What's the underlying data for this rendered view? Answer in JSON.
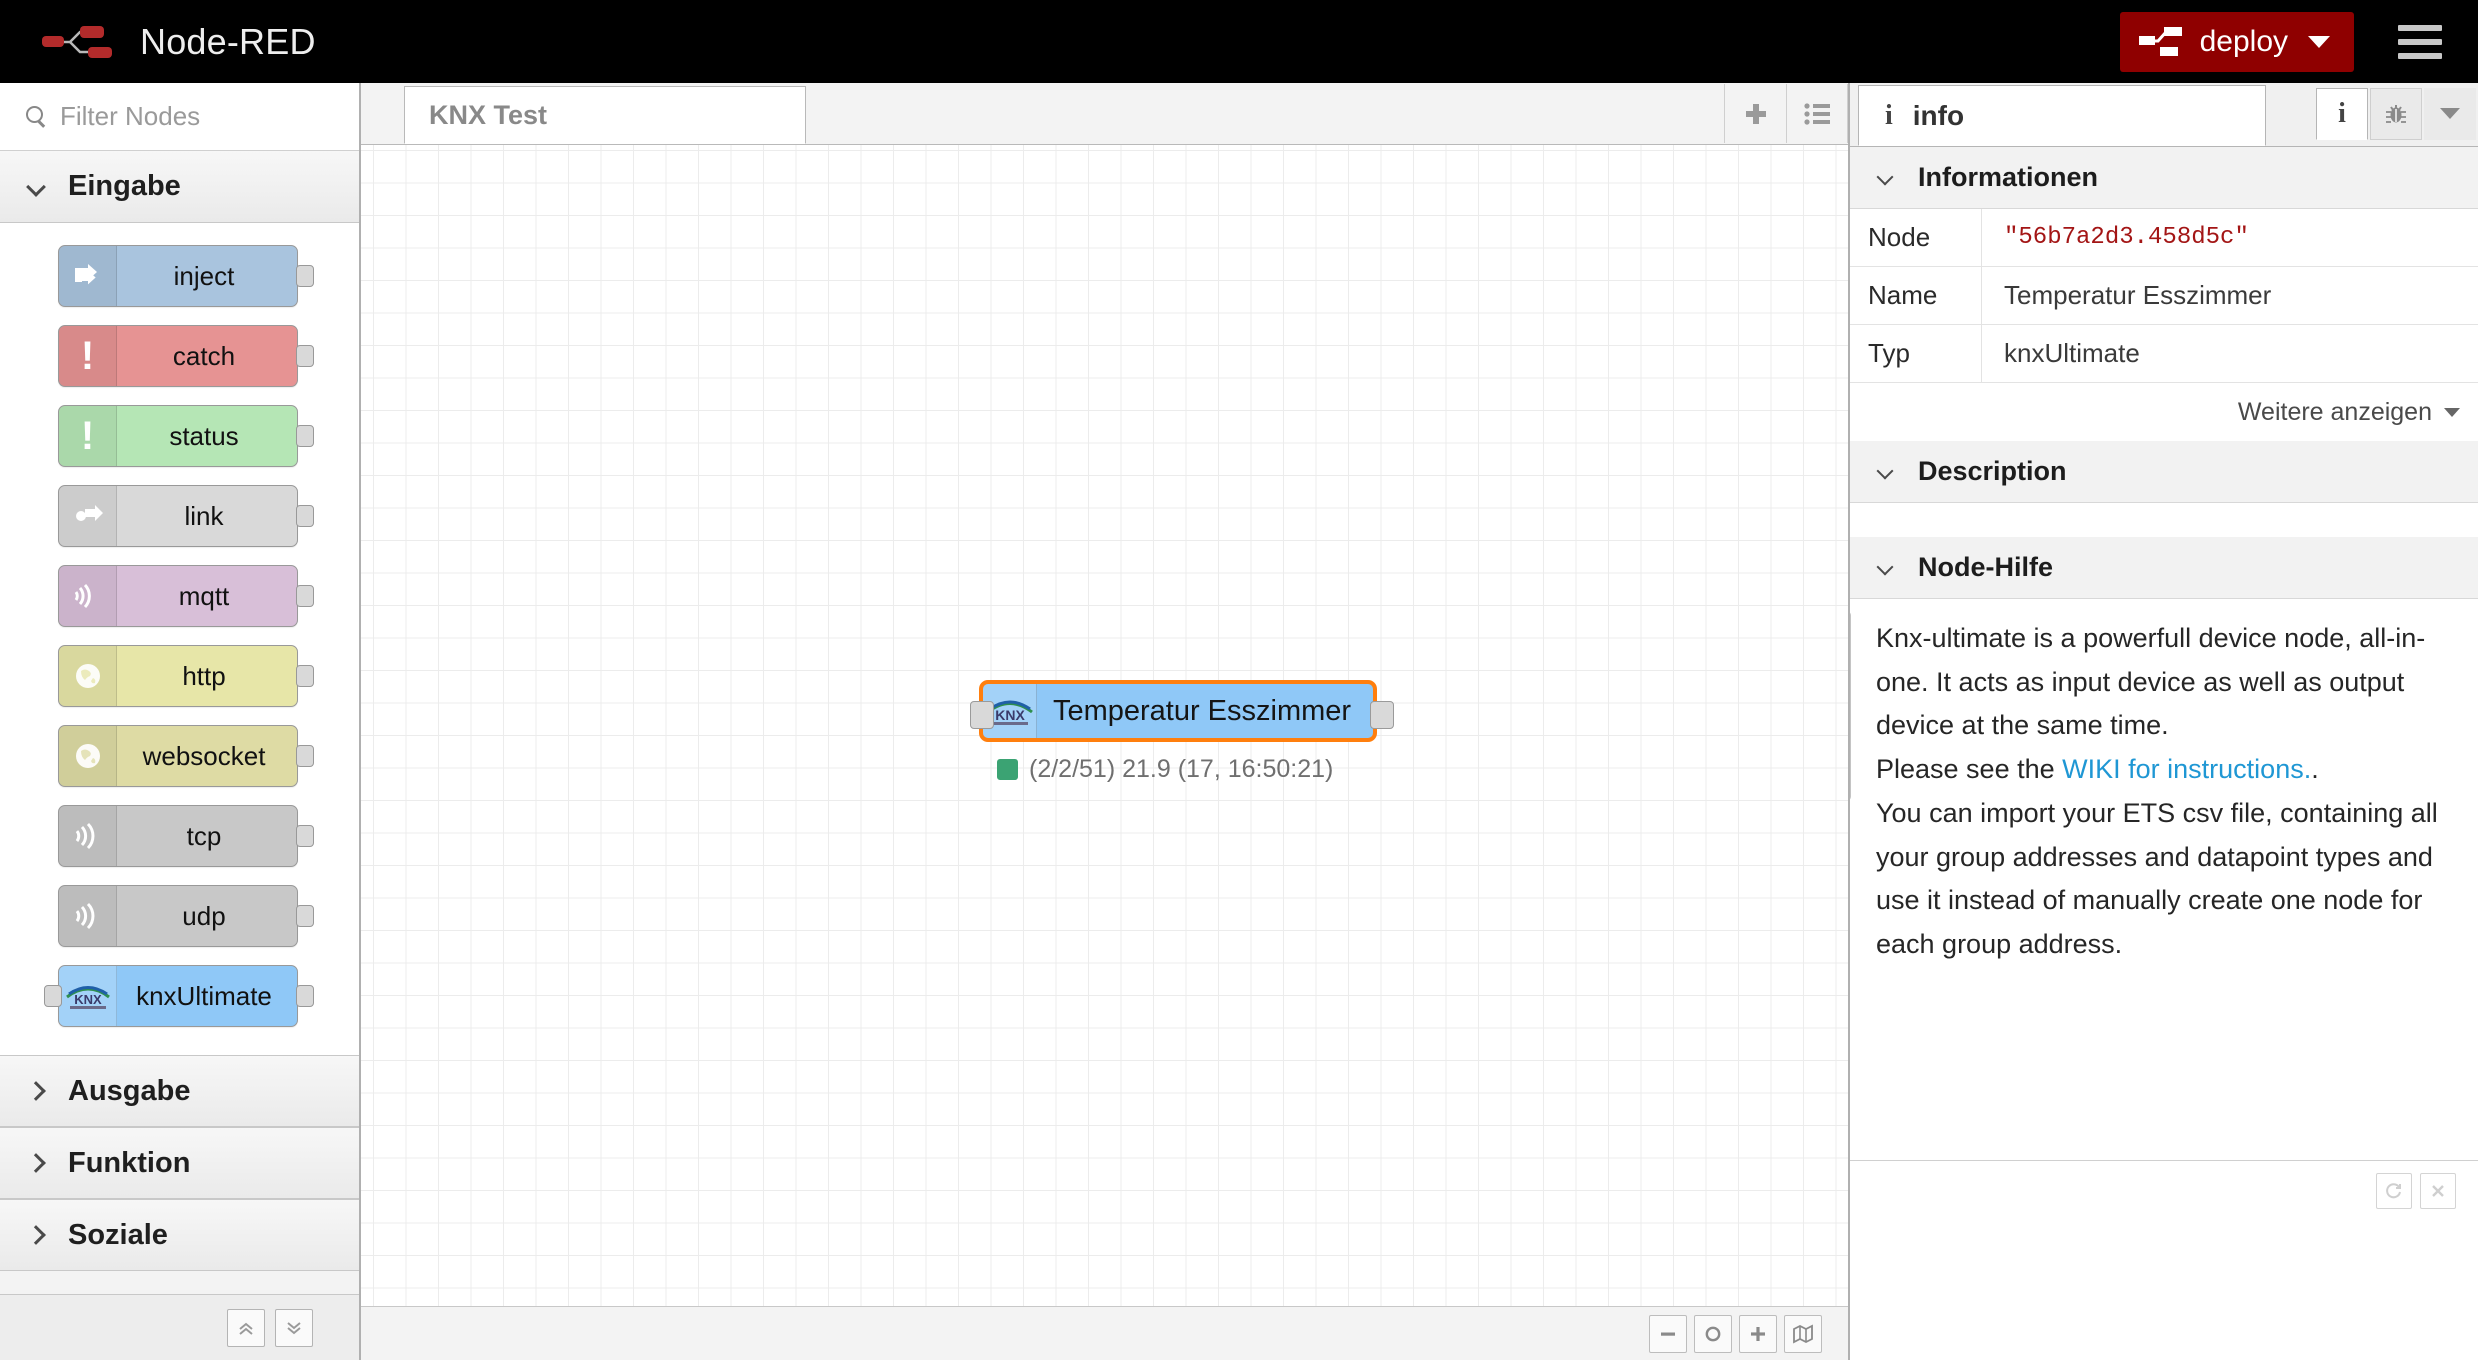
{
  "header": {
    "brand_title": "Node-RED",
    "deploy_label": "deploy",
    "deploy_color": "#8f0000",
    "menu_icon": "hamburger-menu-icon"
  },
  "palette": {
    "search_placeholder": "Filter Nodes",
    "search_value": "",
    "categories": [
      {
        "label": "Eingabe",
        "expanded": true,
        "nodes": [
          {
            "label": "inject",
            "color": "#a9c4de",
            "icon": "inject-arrow-icon",
            "glyph": "⇨",
            "has_input": false,
            "has_output": true
          },
          {
            "label": "catch",
            "color": "#e69393",
            "icon": "exclamation-icon",
            "glyph": "!",
            "has_input": false,
            "has_output": true
          },
          {
            "label": "status",
            "color": "#b5e6b5",
            "icon": "exclamation-icon",
            "glyph": "!",
            "has_input": false,
            "has_output": true
          },
          {
            "label": "link",
            "color": "#d9d9d9",
            "icon": "link-arrow-icon",
            "glyph": "⇨",
            "has_input": false,
            "has_output": true
          },
          {
            "label": "mqtt",
            "color": "#d8bfd8",
            "icon": "signal-wave-icon",
            "glyph": "))",
            "has_input": false,
            "has_output": true
          },
          {
            "label": "http",
            "color": "#e7e6a8",
            "icon": "globe-icon",
            "glyph": "🌍",
            "has_input": false,
            "has_output": true
          },
          {
            "label": "websocket",
            "color": "#dedba4",
            "icon": "globe-icon",
            "glyph": "🌍",
            "has_input": false,
            "has_output": true
          },
          {
            "label": "tcp",
            "color": "#c8c8c8",
            "icon": "signal-wave-icon",
            "glyph": "))",
            "has_input": false,
            "has_output": true
          },
          {
            "label": "udp",
            "color": "#c8c8c8",
            "icon": "signal-wave-icon",
            "glyph": "))",
            "has_input": false,
            "has_output": true
          },
          {
            "label": "knxUltimate",
            "color": "#8fc8f7",
            "icon": "knx-logo-icon",
            "glyph": "KNX",
            "has_input": true,
            "has_output": true
          }
        ]
      },
      {
        "label": "Ausgabe",
        "expanded": false,
        "nodes": []
      },
      {
        "label": "Funktion",
        "expanded": false,
        "nodes": []
      },
      {
        "label": "Soziale",
        "expanded": false,
        "nodes": []
      }
    ],
    "footer": {
      "collapse_all_icon": "chevron-double-up-icon",
      "expand_all_icon": "chevron-double-down-icon"
    }
  },
  "workspace": {
    "tabs": [
      {
        "label": "KNX Test",
        "active": true
      }
    ],
    "add_tab_icon": "plus-icon",
    "list_tabs_icon": "list-icon",
    "node": {
      "name": "Temperatur Esszimmer",
      "icon": "knx-logo-icon",
      "icon_text": "KNX",
      "selected": true,
      "select_color": "#ff7f0e",
      "fill_color": "#8fc8f7",
      "status_text": "(2/2/51) 21.9 (17, 16:50:21)",
      "status_dot_color": "#3ba373"
    },
    "toolbar": {
      "zoom_out_icon": "minus-icon",
      "zoom_reset_icon": "circle-icon",
      "zoom_in_icon": "plus-icon",
      "navigator_icon": "map-icon"
    }
  },
  "sidebar": {
    "tab": {
      "label": "info",
      "icon": "info-i-icon"
    },
    "buttons": [
      {
        "name": "info-tab-button",
        "icon": "info-i-icon",
        "active": true
      },
      {
        "name": "debug-tab-button",
        "icon": "bug-icon",
        "active": false
      },
      {
        "name": "more-tabs-button",
        "icon": "caret-down-icon",
        "active": false
      }
    ],
    "sections": [
      {
        "id": "informationen",
        "label": "Informationen",
        "expanded": true
      },
      {
        "id": "description",
        "label": "Description",
        "expanded": true
      },
      {
        "id": "node_help",
        "label": "Node-Hilfe",
        "expanded": true
      }
    ],
    "info_table": {
      "rows": [
        {
          "key": "Node",
          "value": "\"56b7a2d3.458d5c\"",
          "is_code": true
        },
        {
          "key": "Name",
          "value": "Temperatur Esszimmer",
          "is_code": false
        },
        {
          "key": "Typ",
          "value": "knxUltimate",
          "is_code": false
        }
      ],
      "show_more_label": "Weitere anzeigen"
    },
    "help": {
      "paragraph_1": "Knx-ultimate is a powerfull device node, all-in-one. It acts as input device as well as output device at the same time.",
      "paragraph_2_prefix": "Please see the ",
      "paragraph_2_link": "WIKI for instructions.",
      "paragraph_2_suffix": ".",
      "paragraph_3": "You can import your ETS csv file, containing all your group addresses and datapoint types and use it instead of manually create one node for each group address.",
      "link_color": "#1f97d4"
    },
    "footer": {
      "refresh_icon": "refresh-icon",
      "close_icon": "close-x-icon"
    }
  }
}
